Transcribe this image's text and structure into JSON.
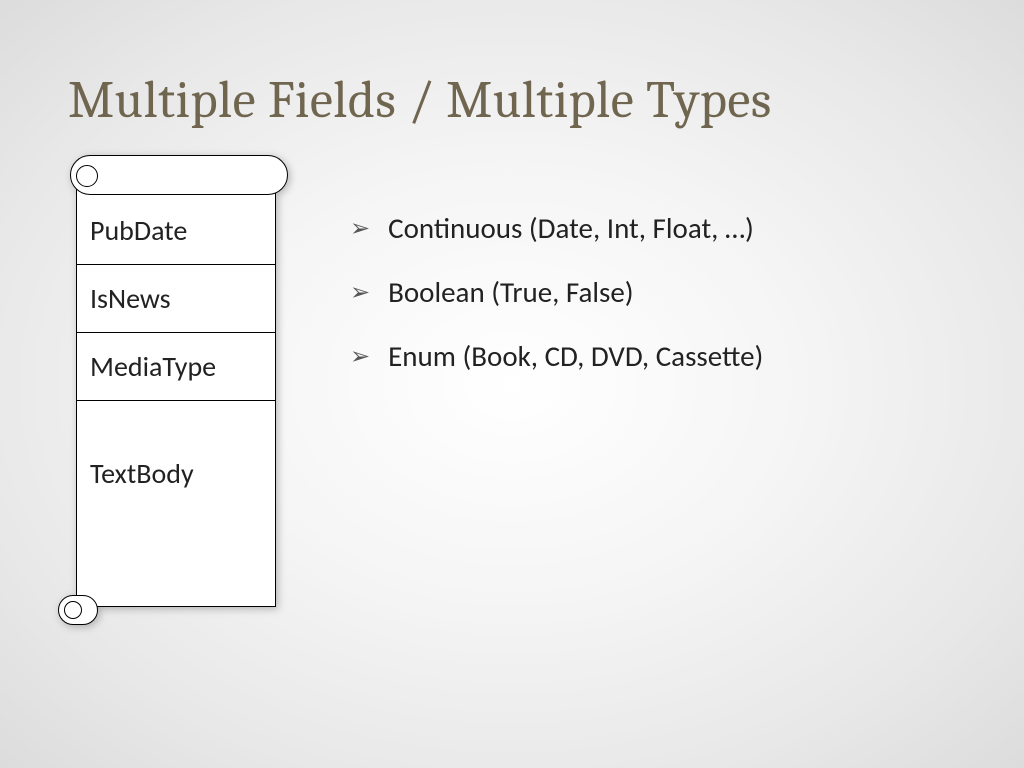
{
  "title": "Multiple Fields / Multiple Types",
  "fields": {
    "f0": "PubDate",
    "f1": "IsNews",
    "f2": "MediaType",
    "f3": "TextBody"
  },
  "bullets": {
    "b0": "Continuous (Date, Int, Float, …)",
    "b1": "Boolean (True, False)",
    "b2": "Enum (Book, CD, DVD, Cassette)"
  }
}
